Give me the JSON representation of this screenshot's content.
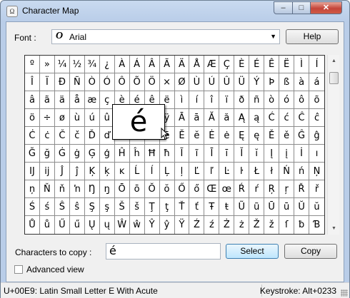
{
  "window": {
    "title": "Character Map",
    "controls": {
      "minimize": "–",
      "maximize": "□",
      "close": "✕"
    }
  },
  "font": {
    "label": "Font :",
    "value": "Arial",
    "icon": "O",
    "help": "Help"
  },
  "grid": {
    "rows": [
      [
        "º",
        "»",
        "¼",
        "½",
        "¾",
        "¿",
        "À",
        "Á",
        "Â",
        "Ã",
        "Ä",
        "Å",
        "Æ",
        "Ç",
        "È",
        "É",
        "Ê",
        "Ë",
        "Ì",
        "Í"
      ],
      [
        "Î",
        "Ï",
        "Ð",
        "Ñ",
        "Ò",
        "Ó",
        "Ô",
        "Õ",
        "Ö",
        "×",
        "Ø",
        "Ù",
        "Ú",
        "Û",
        "Ü",
        "Ý",
        "Þ",
        "ß",
        "à",
        "á"
      ],
      [
        "â",
        "ã",
        "ä",
        "å",
        "æ",
        "ç",
        "è",
        "é",
        "ê",
        "ë",
        "ì",
        "í",
        "î",
        "ï",
        "ð",
        "ñ",
        "ò",
        "ó",
        "ô",
        "õ"
      ],
      [
        "ö",
        "÷",
        "ø",
        "ù",
        "ú",
        "û",
        "ü",
        "ý",
        "þ",
        "ÿ",
        "Ā",
        "ā",
        "Ă",
        "ă",
        "Ą",
        "ą",
        "Ć",
        "ć",
        "Ĉ",
        "ĉ"
      ],
      [
        "Ċ",
        "ċ",
        "Č",
        "č",
        "Ď",
        "ď",
        "Đ",
        "đ",
        "Ē",
        "ē",
        "Ĕ",
        "ĕ",
        "Ė",
        "ė",
        "Ę",
        "ę",
        "Ě",
        "ě",
        "Ĝ",
        "ĝ"
      ],
      [
        "Ğ",
        "ğ",
        "Ġ",
        "ġ",
        "Ģ",
        "ģ",
        "Ĥ",
        "ĥ",
        "Ħ",
        "ħ",
        "Ĩ",
        "ĩ",
        "Ī",
        "ī",
        "Ĭ",
        "ĭ",
        "Į",
        "į",
        "İ",
        "ı"
      ],
      [
        "Ĳ",
        "ĳ",
        "Ĵ",
        "ĵ",
        "Ķ",
        "ķ",
        "ĸ",
        "Ĺ",
        "ĺ",
        "Ļ",
        "ļ",
        "Ľ",
        "ľ",
        "Ŀ",
        "ŀ",
        "Ł",
        "ł",
        "Ń",
        "ń",
        "Ņ"
      ],
      [
        "ņ",
        "Ň",
        "ň",
        "ŉ",
        "Ŋ",
        "ŋ",
        "Ō",
        "ō",
        "Ŏ",
        "ŏ",
        "Ő",
        "ő",
        "Œ",
        "œ",
        "Ŕ",
        "ŕ",
        "Ŗ",
        "ŗ",
        "Ř",
        "ř"
      ],
      [
        "Ś",
        "ś",
        "Ŝ",
        "ŝ",
        "Ş",
        "ş",
        "Š",
        "š",
        "Ţ",
        "ţ",
        "Ť",
        "ť",
        "Ŧ",
        "ŧ",
        "Ũ",
        "ũ",
        "Ū",
        "ū",
        "Ŭ",
        "ŭ"
      ],
      [
        "Ů",
        "ů",
        "Ű",
        "ű",
        "Ų",
        "ų",
        "Ŵ",
        "ŵ",
        "Ŷ",
        "ŷ",
        "Ÿ",
        "Ź",
        "ź",
        "Ż",
        "ż",
        "Ž",
        "ž",
        "ſ",
        "ƀ",
        "Ɓ"
      ]
    ],
    "magnified": "é"
  },
  "copy": {
    "label": "Characters to copy :",
    "value": "é",
    "select": "Select",
    "copy": "Copy"
  },
  "advanced": {
    "label": "Advanced view",
    "checked": false
  },
  "status": {
    "left": "U+00E9: Latin Small Letter E With Acute",
    "right": "Keystroke: Alt+0233"
  }
}
